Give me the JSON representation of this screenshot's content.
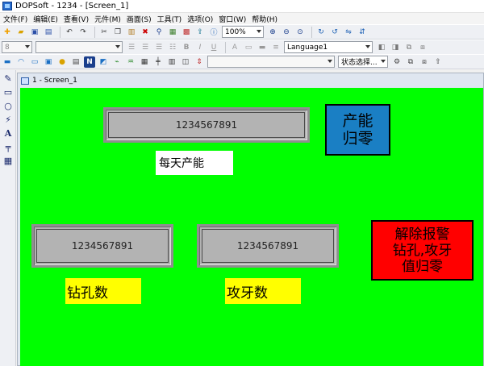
{
  "window": {
    "title": "DOPSoft - 1234 - [Screen_1]"
  },
  "menu": [
    "文件(F)",
    "编辑(E)",
    "查看(V)",
    "元件(M)",
    "画面(S)",
    "工具(T)",
    "选项(O)",
    "窗口(W)",
    "帮助(H)"
  ],
  "toolbar": {
    "zoom": "100%",
    "font_size": "8",
    "language": "Language1",
    "state_select": "状态选择..."
  },
  "doc": {
    "tab_title": "1 - Screen_1"
  },
  "canvas": {
    "display_top": "1234567891",
    "display_left": "1234567891",
    "display_mid": "1234567891",
    "daily_label": "每天产能",
    "drill_label": "钻孔数",
    "tap_label": "攻牙数",
    "btn_reset_output": [
      "产能",
      "归零"
    ],
    "btn_alarm": [
      "解除报警",
      "钻孔,攻牙",
      "值归零"
    ]
  },
  "colors": {
    "canvas_bg": "#00ff00",
    "label_yellow": "#ffff00",
    "button_blue": "#1a7fc4",
    "button_red": "#ff0000",
    "display_gray": "#b3b3b3"
  }
}
